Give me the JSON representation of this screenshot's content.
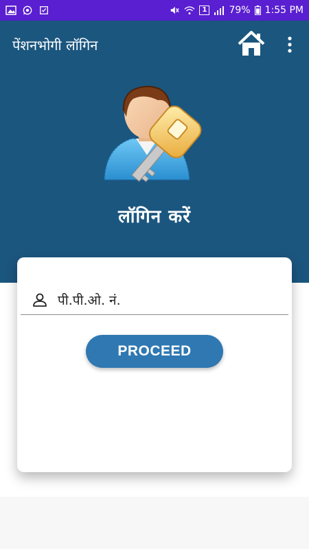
{
  "status_bar": {
    "left_icons": [
      "gallery-icon",
      "whatsapp-icon",
      "task-icon"
    ],
    "right_icons": [
      "mute-icon",
      "wifi-icon",
      "sim1-icon",
      "signal-icon",
      "battery-icon"
    ],
    "sim_slot": "1",
    "battery": "79%",
    "time": "1:55 PM",
    "bg_color": "#5a1fd0"
  },
  "app_bar": {
    "title": "पेंशनभोगी लॉगिन",
    "home_icon": "home-icon",
    "menu_icon": "more-vert-icon",
    "bg_color": "#1b567f"
  },
  "hero": {
    "image": "user-key-icon",
    "title": "लॉगिन करें"
  },
  "login_form": {
    "field_icon": "user-icon",
    "ppo_placeholder": "पी.पी.ओ. नं.",
    "ppo_value": "",
    "proceed_label": "PROCEED",
    "button_color": "#2f78b2"
  }
}
